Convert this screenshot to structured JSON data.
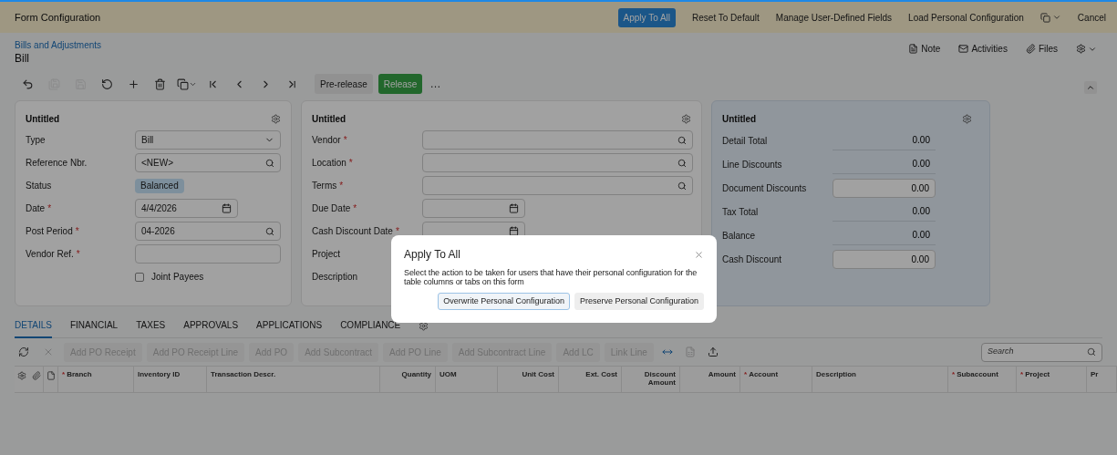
{
  "top_bar": {
    "title": "Form Configuration",
    "actions": [
      {
        "kind": "primary",
        "label": "Apply To All"
      },
      {
        "kind": "link",
        "label": "Reset To Default"
      },
      {
        "kind": "link",
        "label": "Manage User-Defined Fields"
      },
      {
        "kind": "link",
        "label": "Load Personal Configuration"
      },
      {
        "kind": "menu"
      },
      {
        "kind": "link",
        "label": "Cancel"
      }
    ]
  },
  "breadcrumb": "Bills and Adjustments",
  "page_title": "Bill",
  "header_actions": [
    {
      "label": "Note"
    },
    {
      "label": "Activities"
    },
    {
      "label": "Files"
    }
  ],
  "toolbar": {
    "icons": [
      {
        "disabled": false
      },
      {
        "disabled": true
      },
      {
        "disabled": true
      },
      {
        "disabled": false
      },
      {
        "disabled": false
      },
      {
        "disabled": false
      },
      {
        "disabled": false
      },
      {
        "disabled": false
      },
      {
        "disabled": false
      },
      {
        "disabled": false
      },
      {
        "disabled": false
      }
    ],
    "pre_release": "Pre-release",
    "release": "Release",
    "more": "…"
  },
  "panels": [
    {
      "title": "Untitled",
      "fields": [
        {
          "kind": "select",
          "label": "Type",
          "value": "Bill"
        },
        {
          "kind": "lookup",
          "label": "Reference Nbr.",
          "value": "<NEW>"
        },
        {
          "kind": "badge",
          "label": "Status",
          "value": "Balanced"
        },
        {
          "kind": "date",
          "label": "Date",
          "required_mark": "*",
          "value": "4/4/2026"
        },
        {
          "kind": "lookup",
          "label": "Post Period",
          "required_mark": "*",
          "value": "04-2026"
        },
        {
          "kind": "text",
          "label": "Vendor Ref.",
          "required_mark": "*"
        },
        {
          "kind": "checkbox",
          "label": "Joint Payees",
          "checked": false
        }
      ]
    },
    {
      "title": "Untitled",
      "fields": [
        {
          "kind": "lookup",
          "label": "Vendor",
          "required_mark": "*"
        },
        {
          "kind": "lookup",
          "label": "Location",
          "required_mark": "*"
        },
        {
          "kind": "lookup",
          "label": "Terms",
          "required_mark": "*"
        },
        {
          "kind": "date",
          "label": "Due Date",
          "required_mark": "*"
        },
        {
          "kind": "date",
          "label": "Cash Discount Date",
          "required_mark": "*"
        },
        {
          "kind": "plain",
          "label": "Project"
        },
        {
          "kind": "plain",
          "label": "Description"
        }
      ]
    }
  ],
  "totals": {
    "title": "Untitled",
    "rows": [
      {
        "kind": "readonly",
        "label": "Detail Total",
        "value": "0.00"
      },
      {
        "kind": "readonly",
        "label": "Line Discounts",
        "value": "0.00"
      },
      {
        "kind": "input",
        "label": "Document Discounts",
        "value": "0.00"
      },
      {
        "kind": "readonly",
        "label": "Tax Total",
        "value": "0.00"
      },
      {
        "kind": "readonly",
        "label": "Balance",
        "value": "0.00"
      },
      {
        "kind": "input",
        "label": "Cash Discount",
        "value": "0.00"
      }
    ]
  },
  "tabs": [
    {
      "label": "DETAILS",
      "selected": true
    },
    {
      "label": "FINANCIAL",
      "selected": false
    },
    {
      "label": "TAXES",
      "selected": false
    },
    {
      "label": "APPROVALS",
      "selected": false
    },
    {
      "label": "APPLICATIONS",
      "selected": false
    },
    {
      "label": "COMPLIANCE",
      "selected": false
    }
  ],
  "grid_toolbar": {
    "buttons": [
      {
        "label": "Add PO Receipt",
        "disabled": true
      },
      {
        "label": "Add PO Receipt Line",
        "disabled": true
      },
      {
        "label": "Add PO",
        "disabled": true
      },
      {
        "label": "Add Subcontract",
        "disabled": true
      },
      {
        "label": "Add PO Line",
        "disabled": true
      },
      {
        "label": "Add Subcontract Line",
        "disabled": true
      },
      {
        "label": "Add LC",
        "disabled": true
      },
      {
        "label": "Link Line",
        "disabled": true
      }
    ],
    "search": {
      "placeholder": "Search"
    }
  },
  "table": {
    "columns": [
      {
        "label": "Branch",
        "required_mark": "*"
      },
      {
        "label": "Inventory ID"
      },
      {
        "label": "Transaction Descr."
      },
      {
        "label": "Quantity"
      },
      {
        "label": "UOM"
      },
      {
        "label": "Unit Cost"
      },
      {
        "label": "Ext. Cost"
      },
      {
        "label": "Discount Amount"
      },
      {
        "label": "Amount"
      },
      {
        "label": "Account",
        "required_mark": "*"
      },
      {
        "label": "Description"
      },
      {
        "label": "Subaccount",
        "required_mark": "*"
      },
      {
        "label": "Project",
        "required_mark": "*"
      },
      {
        "label": "Pr"
      }
    ]
  },
  "dialog": {
    "title": "Apply To All",
    "message": "Select the action to be taken for users that have their personal configuration for the table columns or tabs on this form",
    "buttons": [
      {
        "label": "Overwrite Personal Configuration",
        "focused": true
      },
      {
        "label": "Preserve Personal Configuration",
        "focused": false
      }
    ]
  }
}
